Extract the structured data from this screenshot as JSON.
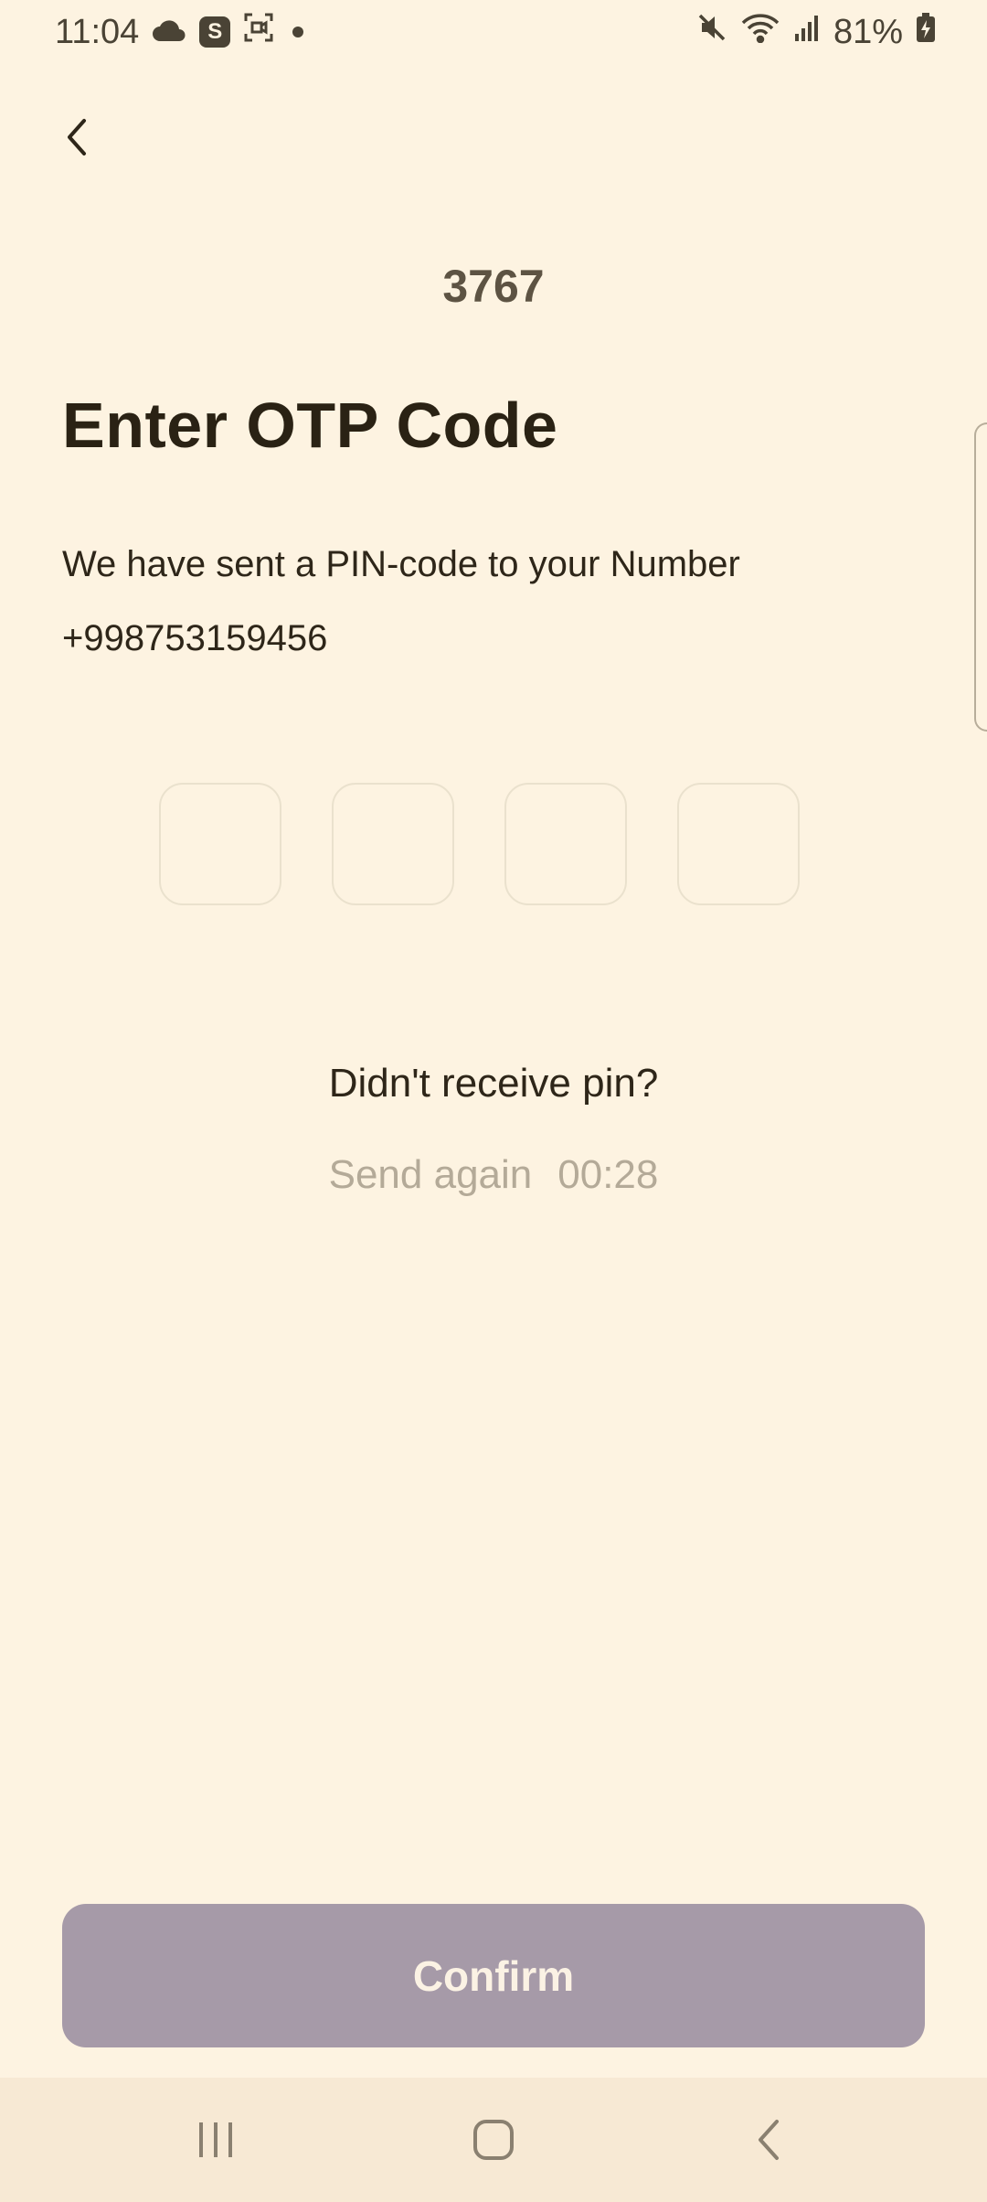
{
  "status_bar": {
    "time": "11:04",
    "battery": "81%",
    "icons": [
      "cloud-icon",
      "s-app-icon",
      "screen-record-icon",
      "notification-dot-icon",
      "mute-icon",
      "wifi-icon",
      "signal-icon",
      "battery-charging-icon"
    ],
    "s_badge": "S"
  },
  "header": {
    "back_icon": "chevron-left-icon"
  },
  "code_hint": "3767",
  "title": "Enter OTP Code",
  "description": "We have sent a PIN-code to your Number",
  "phone_number": "+998753159456",
  "otp": {
    "digits": [
      "",
      "",
      "",
      ""
    ]
  },
  "resend": {
    "question": "Didn't receive pin?",
    "action": "Send again",
    "timer": "00:28"
  },
  "confirm_label": "Confirm",
  "colors": {
    "background": "#fdf3e1",
    "button_disabled": "#a69aa8",
    "muted_text": "#b4aa98",
    "nav_bar": "#f7e9d4"
  },
  "nav_bar": {
    "icons": [
      "recent-apps-icon",
      "home-icon",
      "back-icon"
    ]
  }
}
